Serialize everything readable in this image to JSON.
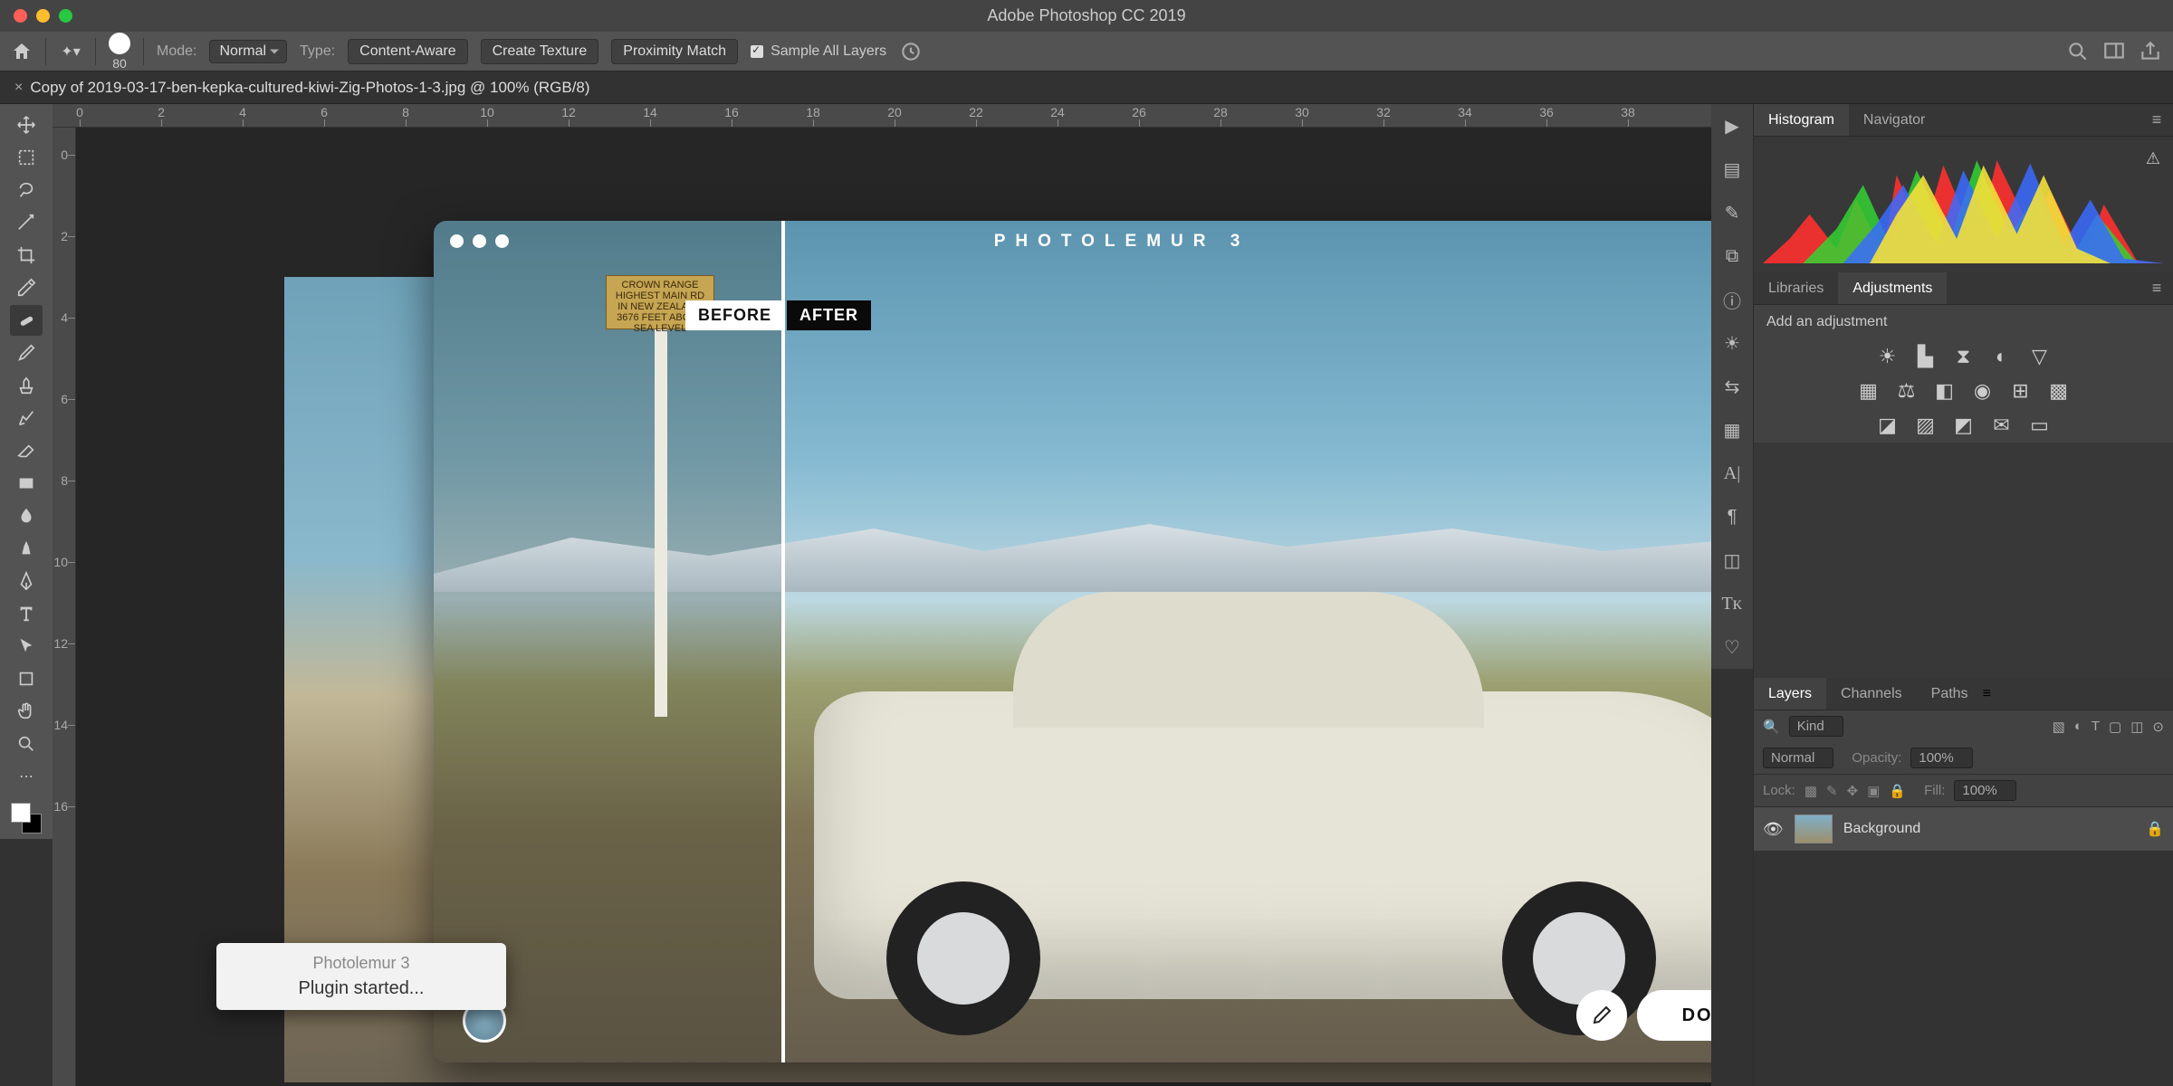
{
  "app": {
    "title": "Adobe Photoshop CC 2019"
  },
  "optbar": {
    "brush_size": "80",
    "mode_label": "Mode:",
    "mode_value": "Normal",
    "type_label": "Type:",
    "btn_content_aware": "Content-Aware",
    "btn_create_texture": "Create Texture",
    "btn_proximity": "Proximity Match",
    "sample_all": "Sample All Layers"
  },
  "document": {
    "tab_title": "Copy of 2019-03-17-ben-kepka-cultured-kiwi-Zig-Photos-1-3.jpg @ 100% (RGB/8)"
  },
  "plugin_window": {
    "title": "PHOTOLEMUR 3",
    "before": "BEFORE",
    "after": "AFTER",
    "done": "DONE",
    "sign": "CROWN RANGE\nHIGHEST MAIN RD\nIN NEW ZEALAND\n3676 FEET ABOVE SEA LEVEL"
  },
  "toast": {
    "title": "Photolemur 3",
    "message": "Plugin started..."
  },
  "panels": {
    "histogram": "Histogram",
    "navigator": "Navigator",
    "libraries": "Libraries",
    "adjustments": "Adjustments",
    "add_adj": "Add an adjustment",
    "layers": "Layers",
    "channels": "Channels",
    "paths": "Paths"
  },
  "layers": {
    "kind": "Kind",
    "blend": "Normal",
    "opacity_lbl": "Opacity:",
    "opacity_val": "100%",
    "lock_lbl": "Lock:",
    "fill_lbl": "Fill:",
    "fill_val": "100%",
    "bg": "Background"
  },
  "ruler_ticks": [
    0,
    2,
    4,
    6,
    8,
    10,
    12,
    14,
    16,
    18,
    20,
    22,
    24,
    26,
    28,
    30,
    32,
    34,
    36,
    38
  ],
  "v_ticks": [
    0,
    2,
    4,
    6,
    8,
    10,
    12,
    14,
    16
  ]
}
